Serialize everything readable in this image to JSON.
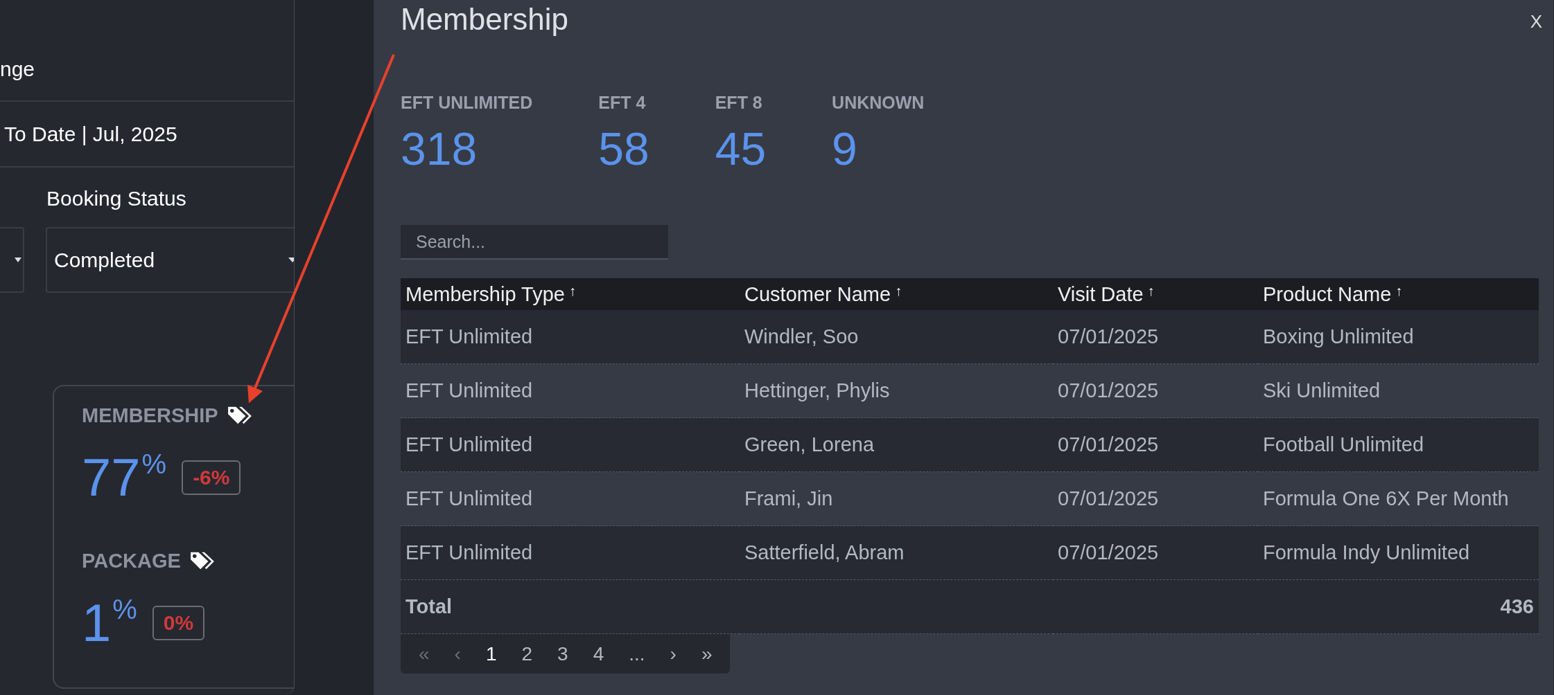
{
  "filters": {
    "range_label": "nge",
    "range_value": "To Date | Jul, 2025",
    "booking_status": {
      "label": "Booking Status",
      "value": "Completed"
    }
  },
  "cards": [
    {
      "title": "MEMBERSHIP",
      "value": "77",
      "unit": "%",
      "change": "-6%"
    },
    {
      "title": "PACKAGE",
      "value": "1",
      "unit": "%",
      "change": "0%"
    }
  ],
  "modal": {
    "title": "Membership",
    "close": "X",
    "stats": [
      {
        "label": "EFT UNLIMITED",
        "value": "318"
      },
      {
        "label": "EFT 4",
        "value": "58"
      },
      {
        "label": "EFT 8",
        "value": "45"
      },
      {
        "label": "UNKNOWN",
        "value": "9"
      }
    ],
    "search": {
      "placeholder": "Search..."
    },
    "table": {
      "columns": [
        {
          "label": "Membership Type",
          "sort": "↑"
        },
        {
          "label": "Customer Name",
          "sort": "↑"
        },
        {
          "label": "Visit Date",
          "sort": "↑"
        },
        {
          "label": "Product Name",
          "sort": "↑"
        }
      ],
      "rows": [
        [
          "EFT Unlimited",
          "Windler, Soo",
          "07/01/2025",
          "Boxing Unlimited"
        ],
        [
          "EFT Unlimited",
          "Hettinger, Phylis",
          "07/01/2025",
          "Ski Unlimited"
        ],
        [
          "EFT Unlimited",
          "Green, Lorena",
          "07/01/2025",
          "Football Unlimited"
        ],
        [
          "EFT Unlimited",
          "Frami, Jin",
          "07/01/2025",
          "Formula One 6X Per Month"
        ],
        [
          "EFT Unlimited",
          "Satterfield, Abram",
          "07/01/2025",
          "Formula Indy Unlimited"
        ]
      ],
      "total": {
        "label": "Total",
        "value": "436"
      }
    },
    "pagination": [
      {
        "label": "«",
        "selected": false,
        "disabled": true
      },
      {
        "label": "‹",
        "selected": false,
        "disabled": true
      },
      {
        "label": "1",
        "selected": true,
        "disabled": false
      },
      {
        "label": "2",
        "selected": false,
        "disabled": false
      },
      {
        "label": "3",
        "selected": false,
        "disabled": false
      },
      {
        "label": "4",
        "selected": false,
        "disabled": false
      },
      {
        "label": "...",
        "selected": false,
        "disabled": false
      },
      {
        "label": "›",
        "selected": false,
        "disabled": false
      },
      {
        "label": "»",
        "selected": false,
        "disabled": false
      }
    ]
  }
}
